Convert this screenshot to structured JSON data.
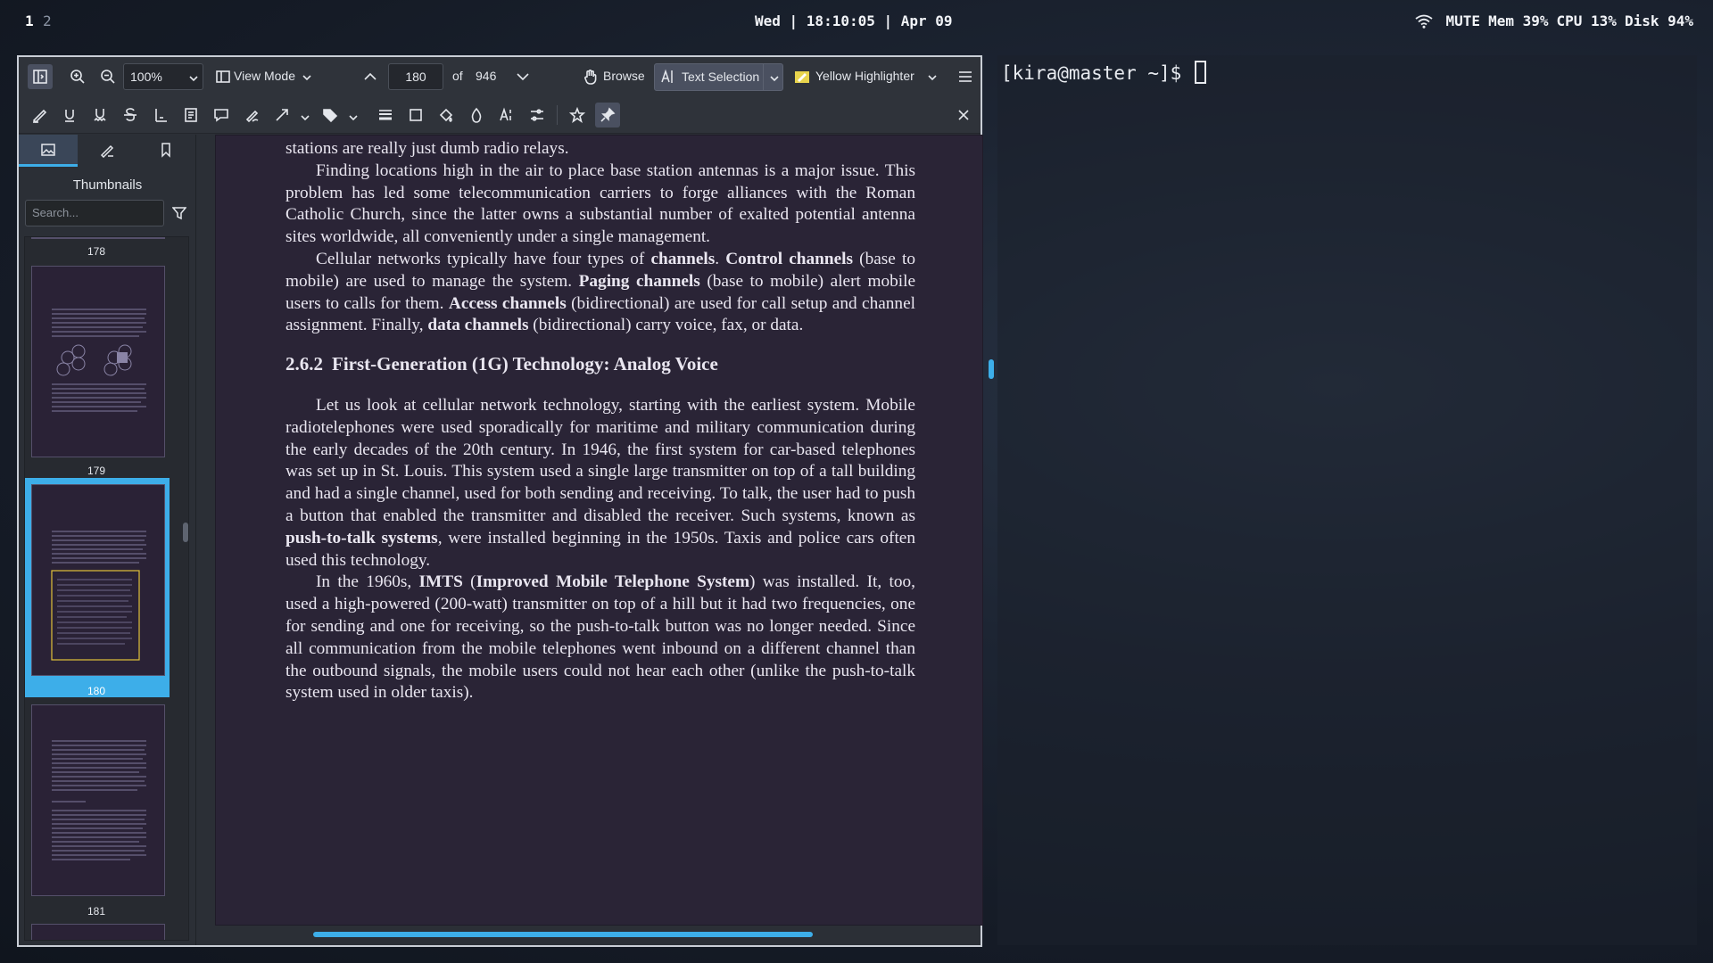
{
  "topbar": {
    "workspaces": [
      "1",
      "2"
    ],
    "clock": "Wed | 18:10:05 | Apr 09",
    "status": {
      "mute": "MUTE",
      "mem": "Mem 39%",
      "cpu": "CPU 13%",
      "disk": "Disk 94%"
    }
  },
  "okular": {
    "toolbar": {
      "zoom_value": "100%",
      "view_mode_label": "View Mode",
      "page_current": "180",
      "page_of": "of",
      "page_total": "946",
      "browse_label": "Browse",
      "text_selection_label": "Text Selection",
      "highlighter_label": "Yellow Highlighter"
    },
    "sidebar": {
      "title": "Thumbnails",
      "search_placeholder": "Search...",
      "thumbnails": [
        {
          "page": "178"
        },
        {
          "page": "179"
        },
        {
          "page": "180",
          "selected": true
        },
        {
          "page": "181"
        }
      ]
    },
    "document": {
      "p0": "stations are really just dumb radio relays.",
      "p1": "Finding locations high in the air to place base station antennas is a major issue. This problem has led some telecommunication carriers to forge alliances with the Roman Catholic Church, since the latter owns a substantial number of exalted potential antenna sites worldwide, all conveniently under a single management.",
      "p2": {
        "a": "Cellular networks typically have four types of ",
        "b1": "channels",
        "c": ". ",
        "b2": "Control channels",
        "d": " (base to mobile) are used to manage the system. ",
        "b3": "Paging channels",
        "e": " (base to mobile) alert mobile users to calls for them. ",
        "b4": "Access channels",
        "f": " (bidirectional) are used for call setup and channel assignment. Finally, ",
        "b5": "data channels",
        "g": " (bidirectional) carry voice, fax, or data."
      },
      "heading_num": "2.6.2",
      "heading_text": "First-Generation (1G) Technology: Analog Voice",
      "p3": {
        "a": "Let us look at cellular network technology, starting with the earliest system. Mobile radiotelephones were used sporadically for maritime and military communication during the early decades of the 20th century. In 1946, the first system for car-based telephones was set up in St. Louis. This system used a single large transmitter on top of a tall building and had a single channel, used for both sending and receiving. To talk, the user had to push a button that enabled the transmitter and disabled the receiver. Such systems, known as ",
        "b1": "push-to-talk systems",
        "c": ", were installed beginning in the 1950s. Taxis and police cars often used this technology."
      },
      "p4": {
        "a": "In the 1960s, ",
        "b1": "IMTS",
        "c": " (",
        "b2": "Improved Mobile Telephone System",
        "d": ") was installed. It, too, used a high-powered (200-watt) transmitter on top of a hill but it had two frequencies, one for sending and one for receiving, so the push-to-talk button was no longer needed. Since all communication from the mobile telephones went inbound on a different channel than the outbound signals, the mobile users could not hear each other (unlike the push-to-talk system used in older taxis)."
      }
    }
  },
  "terminal": {
    "prompt": "[kira@master ~]$ "
  },
  "colors": {
    "accent": "#3daee9",
    "page_bg": "#2a2436",
    "window_bg": "#2f333a"
  }
}
